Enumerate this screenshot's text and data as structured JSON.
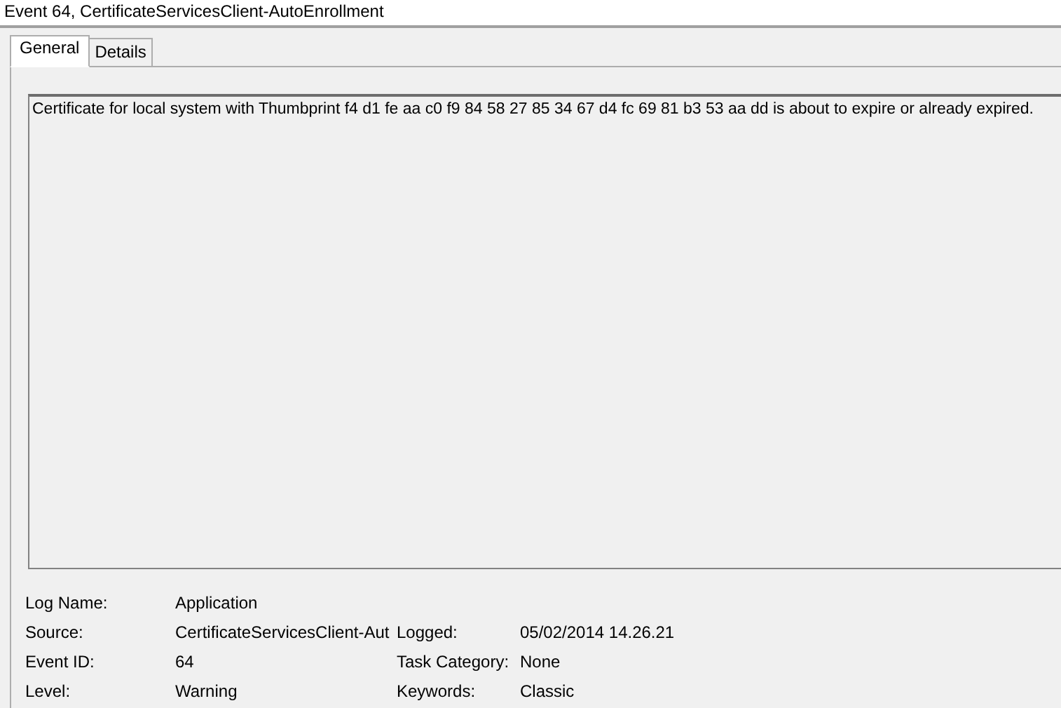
{
  "window": {
    "title": "Event 64, CertificateServicesClient-AutoEnrollment"
  },
  "tabs": [
    {
      "label": "General",
      "selected": true
    },
    {
      "label": "Details",
      "selected": false
    }
  ],
  "description": "Certificate for local system with Thumbprint f4 d1 fe aa c0 f9 84 58 27 85 34 67 d4 fc 69 81 b3 53 aa dd is about to expire or already expired.",
  "properties": [
    [
      {
        "label": "Log Name:",
        "value": "Application"
      }
    ],
    [
      {
        "label": "Source:",
        "value": "CertificateServicesClient-Aut"
      },
      {
        "label": "Logged:",
        "value": "05/02/2014 14.26.21"
      }
    ],
    [
      {
        "label": "Event ID:",
        "value": "64"
      },
      {
        "label": "Task Category:",
        "value": "None"
      }
    ],
    [
      {
        "label": "Level:",
        "value": "Warning"
      },
      {
        "label": "Keywords:",
        "value": "Classic"
      }
    ]
  ]
}
